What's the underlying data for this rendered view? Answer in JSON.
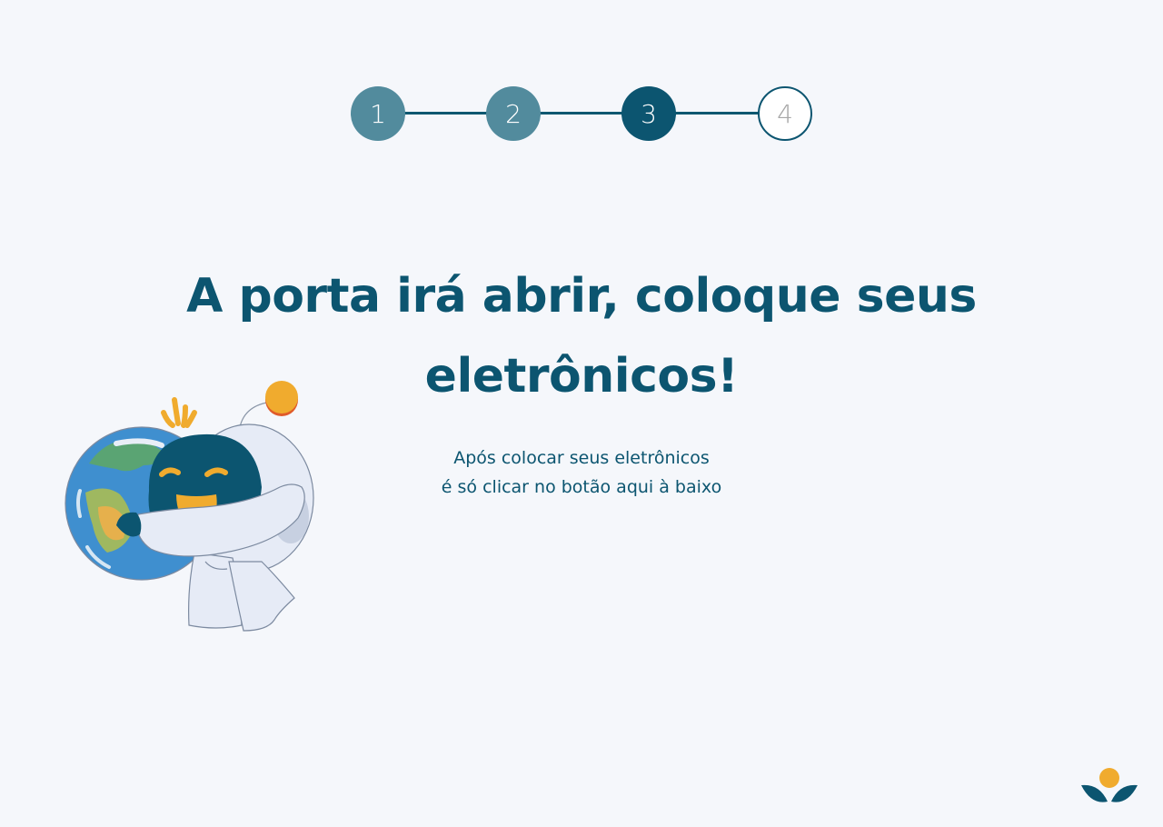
{
  "stepper": {
    "steps": [
      {
        "label": "1",
        "state": "done"
      },
      {
        "label": "2",
        "state": "done"
      },
      {
        "label": "3",
        "state": "current"
      },
      {
        "label": "4",
        "state": "todo"
      }
    ]
  },
  "main": {
    "title": "A porta irá abrir, coloque seus eletrônicos!",
    "subtitle_line1": "Após colocar seus eletrônicos",
    "subtitle_line2": "é só clicar no botão aqui à baixo"
  },
  "illustration": {
    "icon": "robot-hugging-earth-illustration"
  },
  "brand": {
    "icon": "brand-logo-icon",
    "colors": {
      "primary": "#0c5570",
      "secondary": "#528b9d",
      "accent": "#f0ab2e",
      "background": "#f5f7fb"
    }
  }
}
